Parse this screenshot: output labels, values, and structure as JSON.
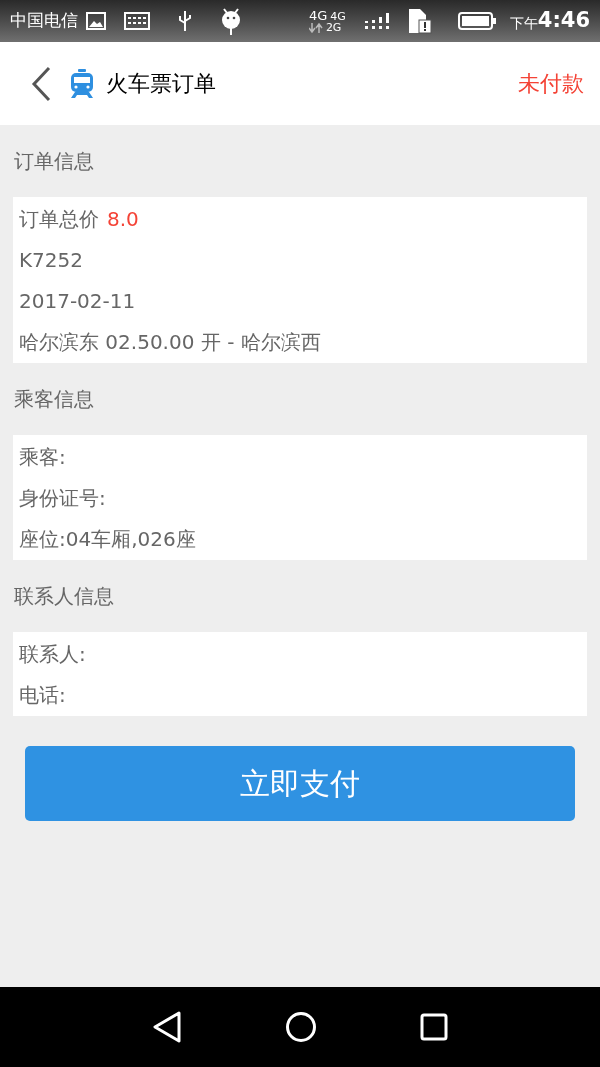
{
  "status_bar": {
    "carrier": "中国电信",
    "network_top": "4G",
    "network_left": "4G",
    "network_right": "2G",
    "time_prefix": "下午",
    "time": "4:46"
  },
  "header": {
    "title": "火车票订单",
    "status": "未付款"
  },
  "sections": [
    {
      "title": "订单信息",
      "rows": [
        {
          "kind": "price",
          "label": "订单总价",
          "value": "8.0"
        },
        {
          "kind": "text",
          "label": "K7252"
        },
        {
          "kind": "text",
          "label": "2017-02-11"
        },
        {
          "kind": "text",
          "label": "哈尔滨东 02.50.00 开 - 哈尔滨西"
        }
      ]
    },
    {
      "title": "乘客信息",
      "rows": [
        {
          "kind": "text",
          "label": "乘客:"
        },
        {
          "kind": "text",
          "label": "身份证号:"
        },
        {
          "kind": "text",
          "label": "座位:04车厢,026座"
        }
      ]
    },
    {
      "title": "联系人信息",
      "rows": [
        {
          "kind": "text",
          "label": "联系人:"
        },
        {
          "kind": "text",
          "label": "电话:"
        }
      ]
    }
  ],
  "pay_button": "立即支付"
}
